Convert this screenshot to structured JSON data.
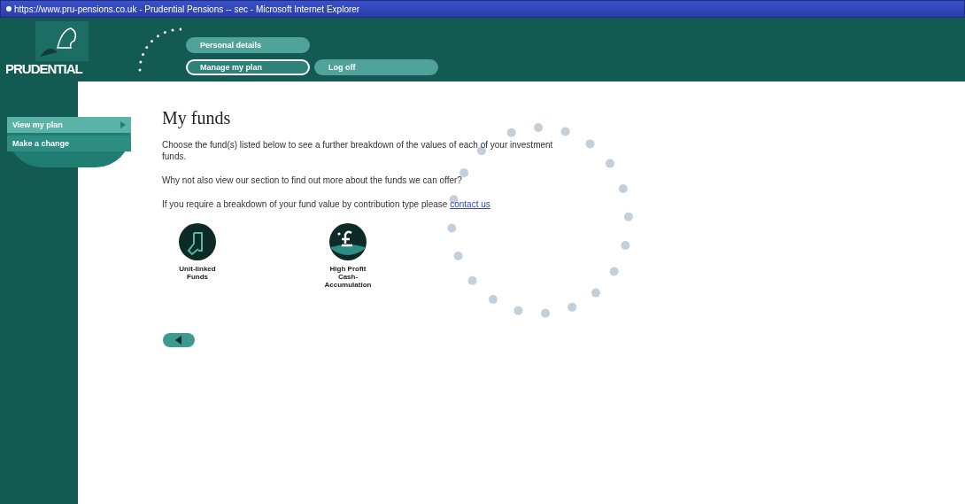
{
  "window": {
    "title": "https://www.pru-pensions.co.uk - Prudential Pensions -- sec - Microsoft Internet Explorer"
  },
  "logo": {
    "text": "PRUDENTIAL"
  },
  "nav": [
    {
      "label": "Personal details",
      "selected": false
    },
    {
      "label": "Manage my plan",
      "selected": true
    },
    {
      "label": "Log off",
      "selected": false
    }
  ],
  "sidebar": {
    "items": [
      {
        "label": "View my plan",
        "selected": true
      },
      {
        "label": "Make a change",
        "selected": false
      }
    ]
  },
  "content": {
    "heading": "My funds",
    "paragraphs": [
      "Choose the fund(s) listed below to see a further breakdown of the values of each of your investment funds.",
      "Why not also view our section to find out more about the funds we can offer?"
    ],
    "contact": {
      "text": "If you require a breakdown of your fund value by contribution type please ",
      "link": "contact us"
    },
    "funds": [
      {
        "kind": "unit",
        "label": "Unit-linked Funds"
      },
      {
        "kind": "cash",
        "label": "High Profit Cash-Accumulation"
      }
    ]
  }
}
